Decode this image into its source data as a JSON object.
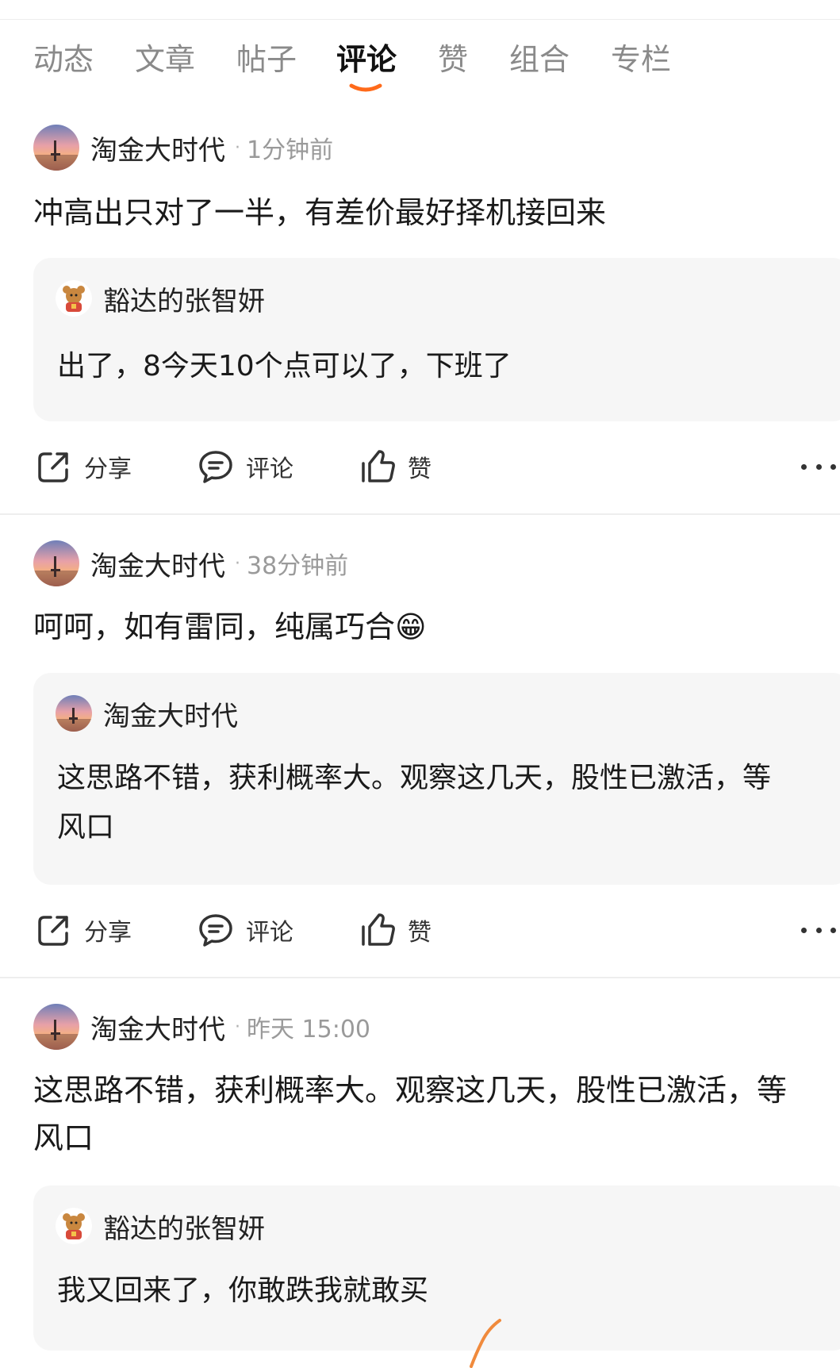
{
  "tabs": [
    {
      "label": "动态",
      "active": false
    },
    {
      "label": "文章",
      "active": false
    },
    {
      "label": "帖子",
      "active": false
    },
    {
      "label": "评论",
      "active": true
    },
    {
      "label": "赞",
      "active": false
    },
    {
      "label": "组合",
      "active": false
    },
    {
      "label": "专栏",
      "active": false
    }
  ],
  "accent_color": "#ff6a1a",
  "actions": {
    "share": "分享",
    "comment": "评论",
    "like": "赞"
  },
  "posts": [
    {
      "author": "淘金大时代",
      "time": "1分钟前",
      "text": "冲高出只对了一半，有差价最好择机接回来",
      "quote": {
        "author": "豁达的张智妍",
        "avatar_icon": "cartoon-avatar-icon",
        "text": "出了，8今天10个点可以了，下班了"
      }
    },
    {
      "author": "淘金大时代",
      "time": "38分钟前",
      "text": "呵呵，如有雷同，纯属巧合",
      "emoji": "😁",
      "quote": {
        "author": "淘金大时代",
        "avatar_icon": "sunset-avatar-icon",
        "text": "这思路不错，获利概率大。观察这几天，股性已激活，等风口"
      }
    },
    {
      "author": "淘金大时代",
      "time": "昨天 15:00",
      "text": "这思路不错，获利概率大。观察这几天，股性已激活，等风口",
      "quote": {
        "author": "豁达的张智妍",
        "avatar_icon": "cartoon-avatar-icon",
        "text": "我又回来了，你敢跌我就敢买"
      }
    }
  ]
}
